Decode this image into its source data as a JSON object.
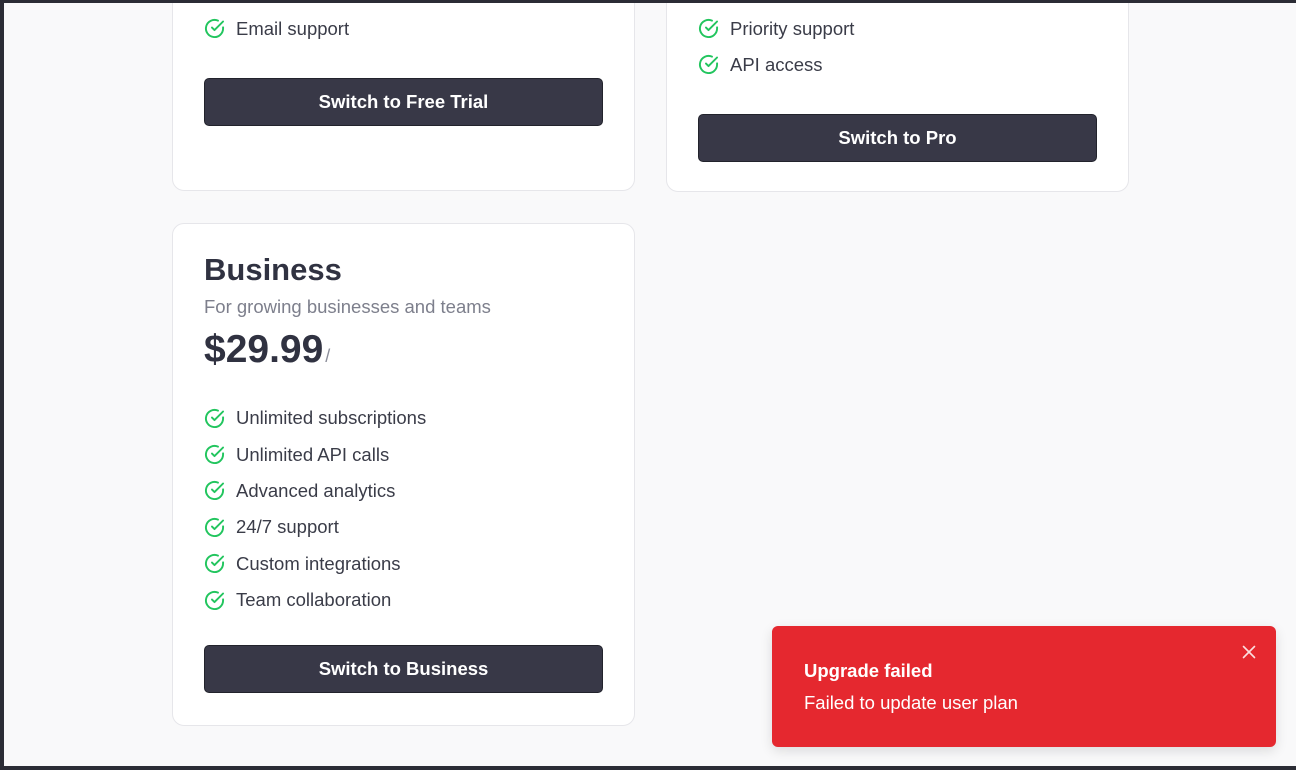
{
  "plans": {
    "free": {
      "features": [
        "Email support"
      ],
      "button_label": "Switch to Free Trial"
    },
    "pro": {
      "features": [
        "Priority support",
        "API access"
      ],
      "button_label": "Switch to Pro"
    },
    "business": {
      "name": "Business",
      "description": "For growing businesses and teams",
      "price": "$29.99",
      "price_separator": "/",
      "features": [
        "Unlimited subscriptions",
        "Unlimited API calls",
        "Advanced analytics",
        "24/7 support",
        "Custom integrations",
        "Team collaboration"
      ],
      "button_label": "Switch to Business"
    }
  },
  "toast": {
    "title": "Upgrade failed",
    "message": "Failed to update user plan"
  },
  "colors": {
    "check_green": "#22c55e",
    "button_bg": "#383847",
    "toast_bg": "#e5282f"
  },
  "icons": {
    "feature": "check-circle-icon",
    "toast_close": "close-icon"
  }
}
